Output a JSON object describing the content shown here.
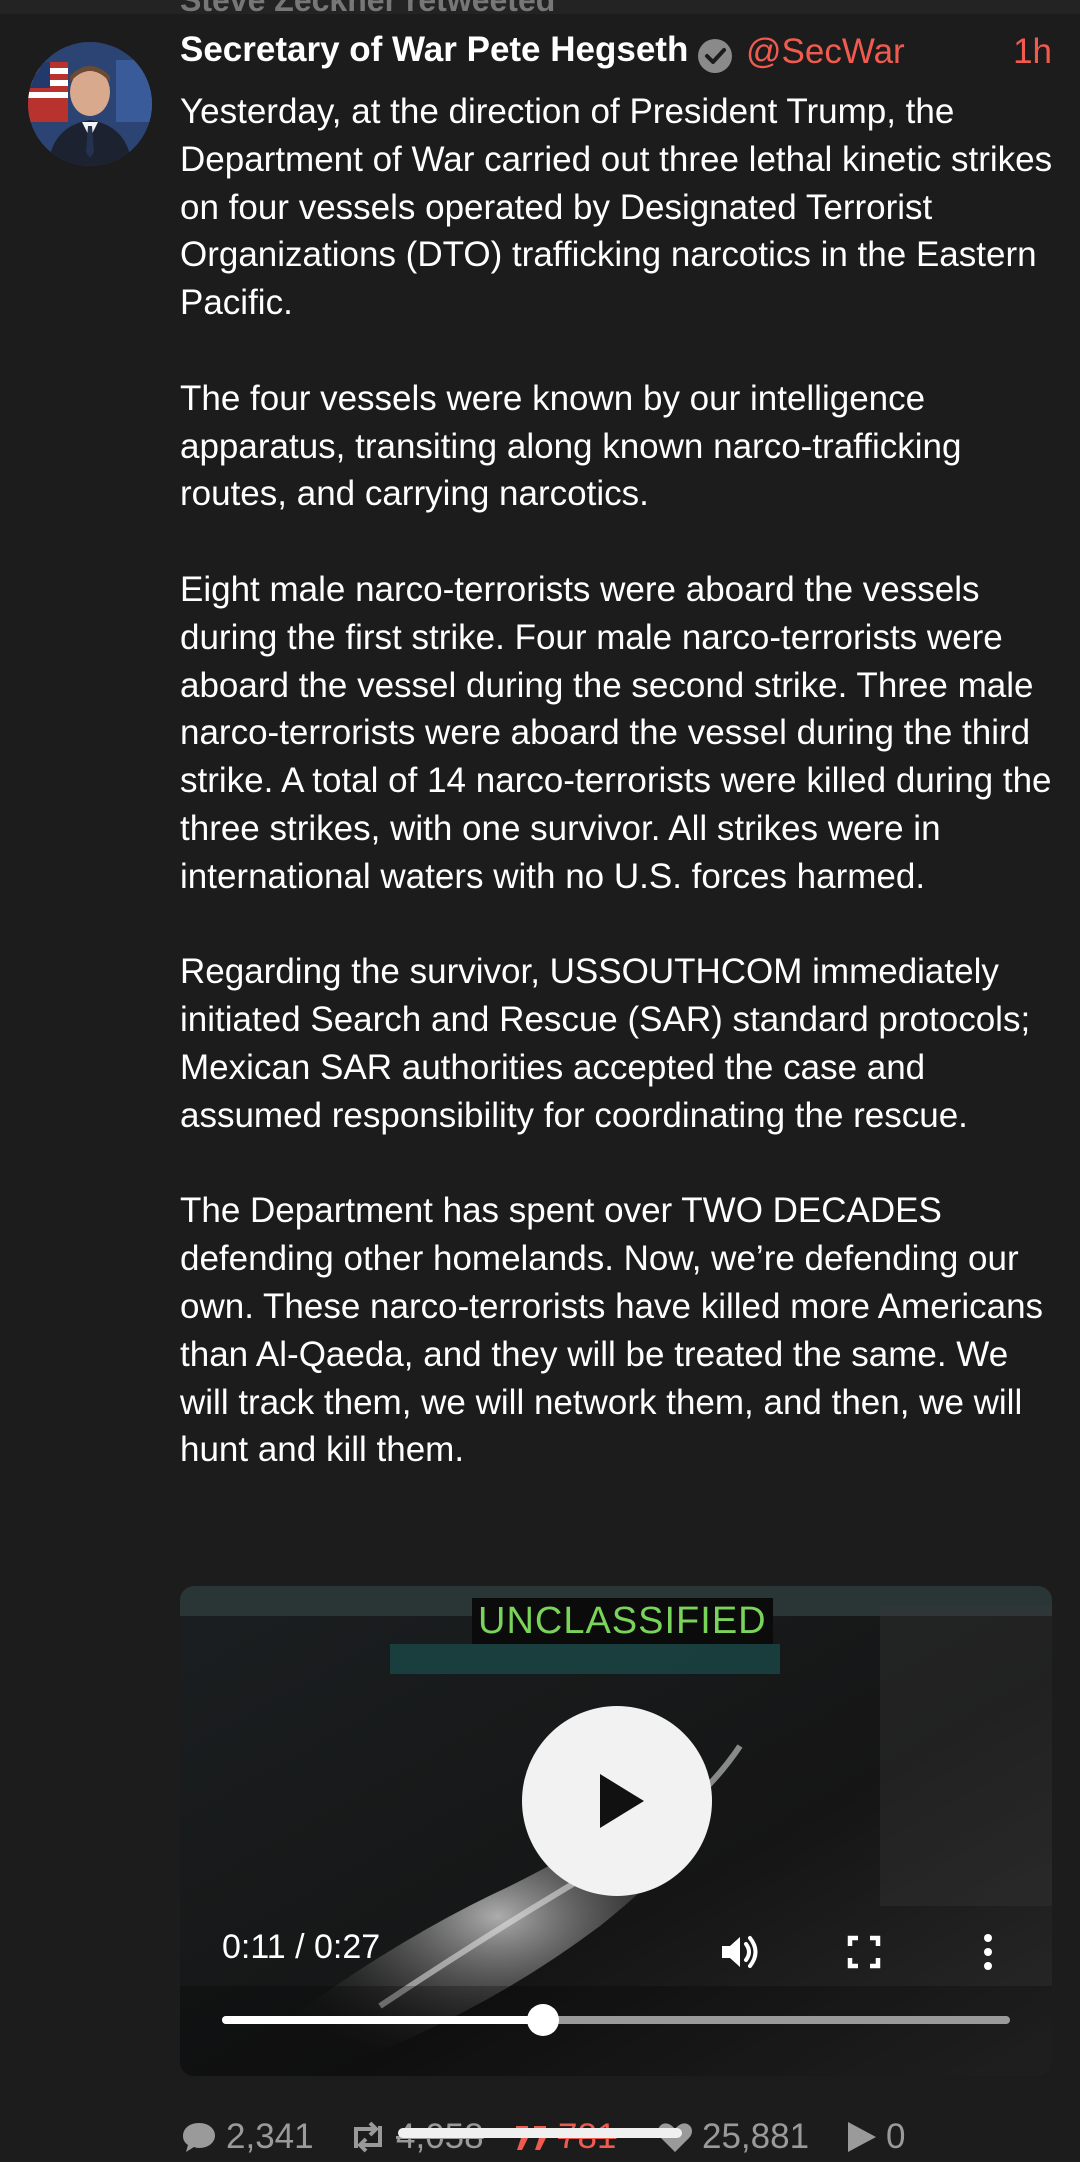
{
  "retweet_label": "Steve Zeckner retweeted",
  "post": {
    "author_name": "Secretary of War Pete Hegseth",
    "handle": "@SecWar",
    "time_ago": "1h",
    "paragraphs": [
      "Yesterday, at the direction of President Trump, the Department of War carried out three lethal kinetic strikes on four vessels operated by Designated Terrorist Organizations (DTO) trafficking narcotics in the Eastern Pacific.",
      "The four vessels were known by our intelligence apparatus, transiting along known narco-trafficking routes, and carrying narcotics.",
      "Eight male narco-terrorists were aboard the vessels during the first strike. Four male narco-terrorists were aboard the vessel during the second strike. Three male narco-terrorists were aboard the vessel during the third strike. A total of 14 narco-terrorists were killed during the three strikes, with one survivor. All strikes were in international waters with no U.S. forces harmed.",
      "Regarding the survivor, USSOUTHCOM immediately initiated Search and Rescue (SAR) standard protocols; Mexican SAR authorities accepted the case and assumed responsibility for coordinating the rescue.",
      "The Department has spent over TWO DECADES defending other homelands. Now, we’re defending our own. These narco-terrorists have killed more Americans than Al-Qaeda, and they will be treated the same. We will track them, we will network them, and then, we will hunt and kill them."
    ]
  },
  "video": {
    "overlay_label": "UNCLASSIFIED",
    "current_time": "0:11",
    "duration": "0:27",
    "time_display": "0:11 / 0:27",
    "progress_fraction": 0.4074
  },
  "actions": {
    "replies": "2,341",
    "reposts": "4,058",
    "quotes": "781",
    "likes": "25,881",
    "plays": "0"
  },
  "colors": {
    "background": "#1c1c1c",
    "accent": "#f15b4f",
    "muted": "#9a9a9a",
    "overlay_green": "#7ad35a"
  },
  "icons": [
    "verified-badge-icon",
    "play-icon",
    "volume-icon",
    "fullscreen-icon",
    "more-vert-icon",
    "reply-icon",
    "repost-icon",
    "quote-icon",
    "like-icon",
    "plays-icon"
  ]
}
